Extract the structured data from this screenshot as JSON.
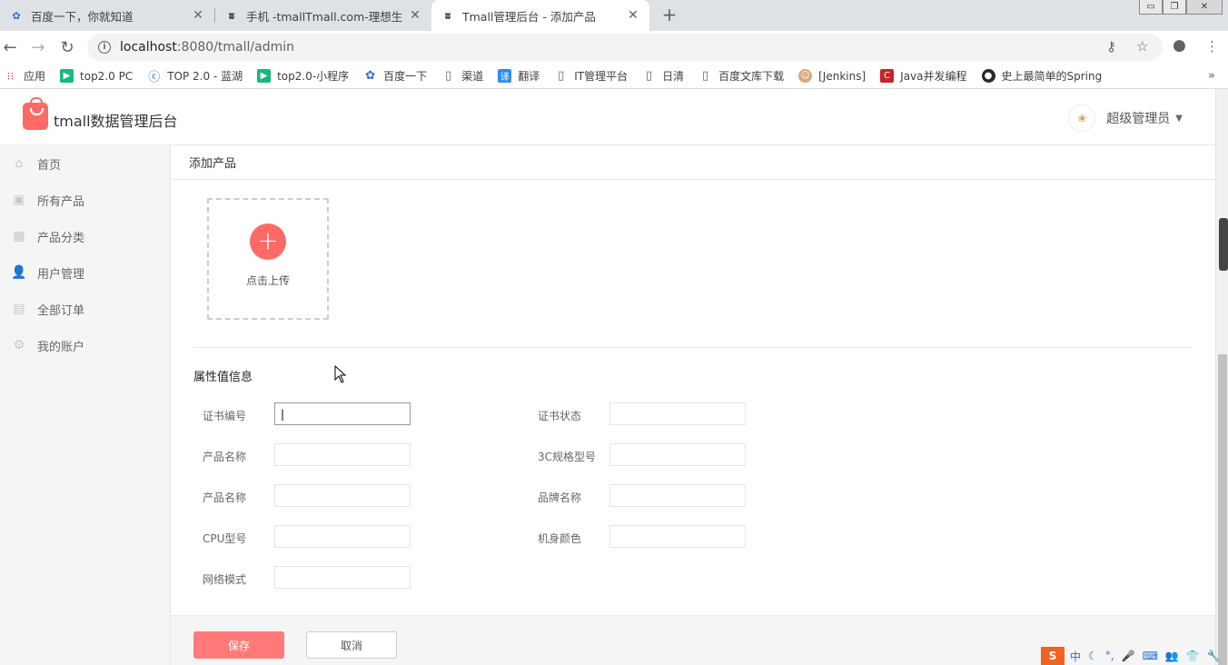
{
  "browser": {
    "tabs": [
      {
        "title": "百度一下，你就知道",
        "active": false
      },
      {
        "title": "手机 -tmallTmall.com-理想生活",
        "active": false
      },
      {
        "title": "Tmall管理后台 - 添加产品",
        "active": true
      }
    ],
    "new_tab": "+",
    "url_host": "localhost",
    "url_rest": ":8080/tmall/admin",
    "window_buttons": {
      "minimize": "▭",
      "restore": "❐",
      "close": "✕"
    }
  },
  "bookmarks": {
    "items": [
      {
        "label": "应用",
        "icon": "apps-grid-icon",
        "color": "#e94235"
      },
      {
        "label": "top2.0 PC",
        "icon": "play-icon",
        "color": "#17b978"
      },
      {
        "label": "TOP 2.0 - 蓝湖",
        "icon": "lanhu-icon",
        "color": "#1f6fd1"
      },
      {
        "label": "top2.0-小程序",
        "icon": "play-icon",
        "color": "#17b978"
      },
      {
        "label": "百度一下",
        "icon": "baidu-paw-icon",
        "color": "#2f6bd8"
      },
      {
        "label": "渠道",
        "icon": "page-icon",
        "color": "#ffffff"
      },
      {
        "label": "翻译",
        "icon": "translate-icon",
        "color": "#2f8cf0"
      },
      {
        "label": "IT管理平台",
        "icon": "page-icon",
        "color": "#ffffff"
      },
      {
        "label": "日清",
        "icon": "page-icon",
        "color": "#ffffff"
      },
      {
        "label": "百度文库下载",
        "icon": "page-icon",
        "color": "#ffffff"
      },
      {
        "label": "[Jenkins]",
        "icon": "jenkins-icon",
        "color": "#d9a679"
      },
      {
        "label": "Java并发编程",
        "icon": "java-icon",
        "color": "#c6242b"
      },
      {
        "label": "史上最简单的Spring",
        "icon": "github-icon",
        "color": "#24292e"
      }
    ],
    "more": "»"
  },
  "app": {
    "title": "tmall数据管理后台",
    "user_name": "超级管理员",
    "brand_color": "#ff6a66"
  },
  "sidebar": {
    "items": [
      {
        "label": "首页",
        "icon": "home-icon"
      },
      {
        "label": "所有产品",
        "icon": "inbox-icon"
      },
      {
        "label": "产品分类",
        "icon": "grid-icon"
      },
      {
        "label": "用户管理",
        "icon": "user-icon"
      },
      {
        "label": "全部订单",
        "icon": "clipboard-icon"
      },
      {
        "label": "我的账户",
        "icon": "gear-icon"
      }
    ]
  },
  "main": {
    "page_title": "添加产品",
    "upload_label": "点击上传",
    "upload_plus": "+",
    "section_title": "属性值信息",
    "fields": [
      {
        "label": "证书编号",
        "value": "|"
      },
      {
        "label": "证书状态",
        "value": ""
      },
      {
        "label": "产品名称",
        "value": ""
      },
      {
        "label": "3C规格型号",
        "value": ""
      },
      {
        "label": "产品名称",
        "value": ""
      },
      {
        "label": "品牌名称",
        "value": ""
      },
      {
        "label": "CPU型号",
        "value": ""
      },
      {
        "label": "机身颜色",
        "value": ""
      },
      {
        "label": "网络模式",
        "value": ""
      }
    ],
    "save_label": "保存",
    "cancel_label": "取消"
  },
  "ime": {
    "logo": "S",
    "lang": "中"
  }
}
